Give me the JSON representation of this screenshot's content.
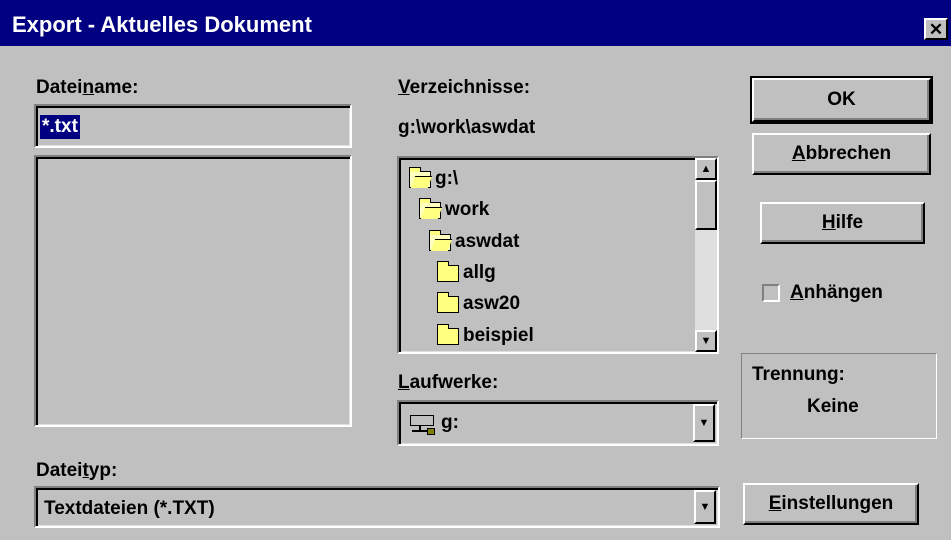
{
  "window": {
    "title": "Export - Aktuelles Dokument",
    "close_glyph": "✕"
  },
  "filename": {
    "label_pre": "Datei",
    "label_accel": "n",
    "label_post": "ame:",
    "value": "*.txt",
    "files": []
  },
  "directories": {
    "label_accel": "V",
    "label_post": "erzeichnisse:",
    "current_path": "g:\\work\\aswdat",
    "items": [
      {
        "name": "g:\\",
        "icon": "open-folder-icon"
      },
      {
        "name": "work",
        "icon": "open-folder-icon"
      },
      {
        "name": "aswdat",
        "icon": "open-folder-icon"
      },
      {
        "name": "allg",
        "icon": "folder-icon"
      },
      {
        "name": "asw20",
        "icon": "folder-icon"
      },
      {
        "name": "beispiel",
        "icon": "folder-icon"
      }
    ]
  },
  "drives": {
    "label_accel": "L",
    "label_post": "aufwerke:",
    "value": "g:",
    "icon": "network-drive-icon"
  },
  "filetype": {
    "label_pre": "Datei",
    "label_accel": "t",
    "label_post": "yp:",
    "value": "Textdateien (*.TXT)"
  },
  "buttons": {
    "ok": "OK",
    "cancel_accel": "A",
    "cancel_post": "bbrechen",
    "help_accel": "H",
    "help_post": "ilfe",
    "settings_accel": "E",
    "settings_post": "instellungen"
  },
  "append": {
    "accel": "A",
    "post": "nhängen",
    "checked": false
  },
  "separator": {
    "label": "Trennung:",
    "value": "Keine"
  },
  "colors": {
    "titlebar": "#000080",
    "face": "#c0c0c0",
    "highlight": "#000080"
  }
}
